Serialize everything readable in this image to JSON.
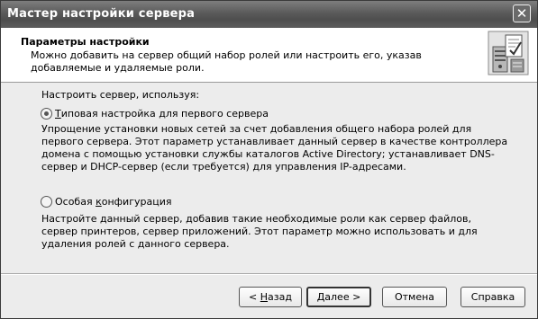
{
  "window": {
    "title": "Мастер настройки сервера"
  },
  "header": {
    "title": "Параметры настройки",
    "description": "Можно добавить на сервер общий набор ролей или настроить его, указав добавляемые и удаляемые роли."
  },
  "body": {
    "prompt": "Настроить сервер, используя:",
    "options": [
      {
        "label_access_key": "Т",
        "label_rest": "иповая настройка для первого сервера",
        "checked": true,
        "description": "Упрощение установки новых сетей за счет добавления общего набора ролей для первого сервера. Этот параметр устанавливает данный сервер в качестве контроллера домена с помощью установки службы каталогов Active Directory; устанавливает DNS-сервер и DHCP-сервер (если требуется) для управления IP-адресами."
      },
      {
        "label_prefix": "Особая ",
        "label_access_key": "к",
        "label_rest": "онфигурация",
        "checked": false,
        "description": "Настройте данный сервер, добавив такие необходимые роли как сервер файлов, сервер принтеров, сервер приложений. Этот параметр можно использовать и для удаления ролей с данного сервера."
      }
    ]
  },
  "buttons": {
    "back_prefix": "< ",
    "back_access_key": "Н",
    "back_rest": "азад",
    "next_access_key": "Д",
    "next_rest": "алее >",
    "cancel": "Отмена",
    "help": "Справка"
  }
}
